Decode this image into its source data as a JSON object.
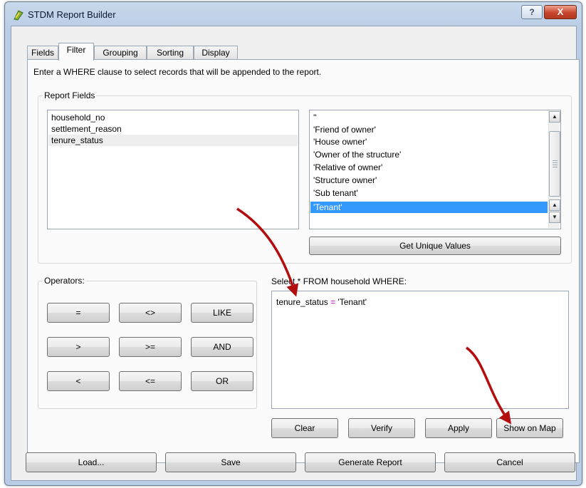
{
  "window": {
    "title": "STDM Report Builder",
    "help_label": "?",
    "close_label": "X"
  },
  "tabs": [
    {
      "label": "Fields",
      "active": false
    },
    {
      "label": "Filter",
      "active": true
    },
    {
      "label": "Grouping",
      "active": false
    },
    {
      "label": "Sorting",
      "active": false
    },
    {
      "label": "Display",
      "active": false
    }
  ],
  "filter": {
    "instruction": "Enter a WHERE clause to select records that will be appended to the report.",
    "report_fields_title": "Report Fields",
    "fields": [
      "household_no",
      "settlement_reason",
      "tenure_status"
    ],
    "selected_field": "tenure_status",
    "values": [
      "''",
      "'Friend of owner'",
      "'House owner'",
      "'Owner of the structure'",
      "'Relative of owner'",
      "'Structure owner'",
      "'Sub tenant'",
      "'Tenant'"
    ],
    "selected_value": "'Tenant'",
    "get_unique_values_label": "Get Unique Values",
    "operators_title": "Operators:",
    "operators": [
      "=",
      "<>",
      "LIKE",
      ">",
      ">=",
      "AND",
      "<",
      "<=",
      "OR"
    ],
    "sql_label": "Select * FROM household WHERE:",
    "sql_field": "tenure_status",
    "sql_operator": "=",
    "sql_value": "'Tenant'",
    "clear_label": "Clear",
    "verify_label": "Verify",
    "apply_label": "Apply",
    "show_on_map_label": "Show on Map"
  },
  "footer": {
    "load_label": "Load...",
    "save_label": "Save",
    "generate_label": "Generate Report",
    "cancel_label": "Cancel"
  },
  "annotation": {
    "arrow_color": "#b30d0d"
  }
}
